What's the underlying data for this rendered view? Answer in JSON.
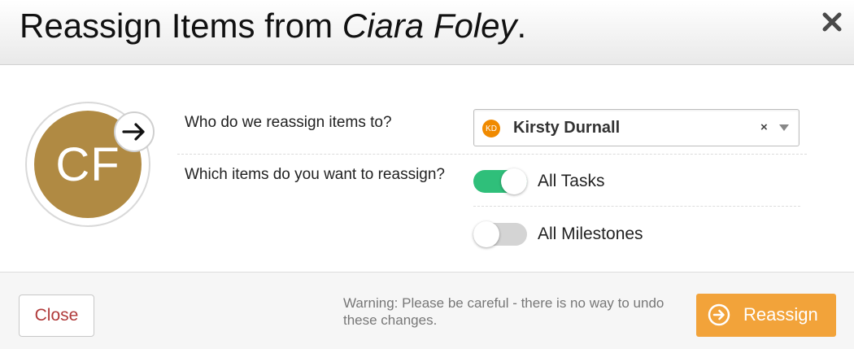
{
  "dialog": {
    "title_prefix": "Reassign Items from ",
    "title_name": "Ciara Foley",
    "title_suffix": "."
  },
  "source_user": {
    "initials": "CF",
    "avatar_color": "#b08a43"
  },
  "questions": {
    "reassign_to": "Who do we reassign items to?",
    "which_items": "Which items do you want to reassign?"
  },
  "assignee_select": {
    "initials": "KD",
    "name": "Kirsty Durnall",
    "badge_color": "#f08a00",
    "clear_glyph": "×"
  },
  "options": [
    {
      "label": "All Tasks",
      "enabled": true
    },
    {
      "label": "All Milestones",
      "enabled": false
    }
  ],
  "footer": {
    "close_label": "Close",
    "warning": "Warning: Please be careful - there is no way to undo these changes.",
    "reassign_label": "Reassign",
    "reassign_color": "#f2a33a"
  }
}
